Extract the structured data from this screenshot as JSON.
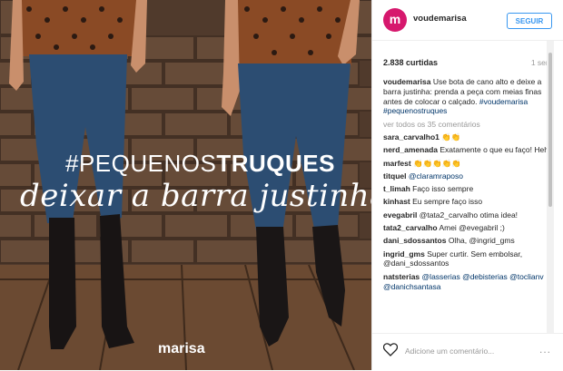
{
  "post": {
    "hashtag_light": "#PEQUENOS",
    "hashtag_bold": "TRUQUES",
    "script_text": "deixar a barra justinha",
    "brand_logo": "marisa"
  },
  "header": {
    "avatar_letter": "m",
    "username": "voudemarisa",
    "follow_label": "SEGUIR"
  },
  "stats": {
    "likes": "2.838 curtidas",
    "age": "1 sem"
  },
  "caption": {
    "user": "voudemarisa",
    "text": "Use bota de cano alto e deixe a barra justinha: prenda a peça com meias finas antes de colocar o calçado.",
    "mentions": "#voudemarisa #pequenostruques"
  },
  "view_all": "ver todos os 35 comentários",
  "comments": [
    {
      "user": "sara_carvalho1",
      "text": "👏👏"
    },
    {
      "user": "nerd_amenada",
      "text": "Exatamente o que eu faço! Hehe"
    },
    {
      "user": "marfest",
      "text": "👏👏👏👏👏"
    },
    {
      "user": "titquel",
      "text": "@claramraposo"
    },
    {
      "user": "t_limah",
      "text": "Faço isso sempre"
    },
    {
      "user": "kinhast",
      "text": "Eu sempre faço isso"
    },
    {
      "user": "evegabril",
      "text": "@tata2_carvalho otima idea!"
    },
    {
      "user": "tata2_carvalho",
      "text": "Amei @evegabril ;)"
    },
    {
      "user": "dani_sdossantos",
      "text": "Olha, @ingrid_gms"
    },
    {
      "user": "ingrid_gms",
      "text": "Super curtir. Sem embolsar, @dani_sdossantos"
    },
    {
      "user": "natsterias",
      "text": "@lasserias @debisterias @toclianv @danichsantasa"
    }
  ],
  "footer": {
    "add_comment_placeholder": "Adicione um comentário...",
    "more_label": "..."
  },
  "colors": {
    "brand_pink": "#d6186d",
    "link_blue": "#3897f0",
    "mention_navy": "#003569"
  }
}
